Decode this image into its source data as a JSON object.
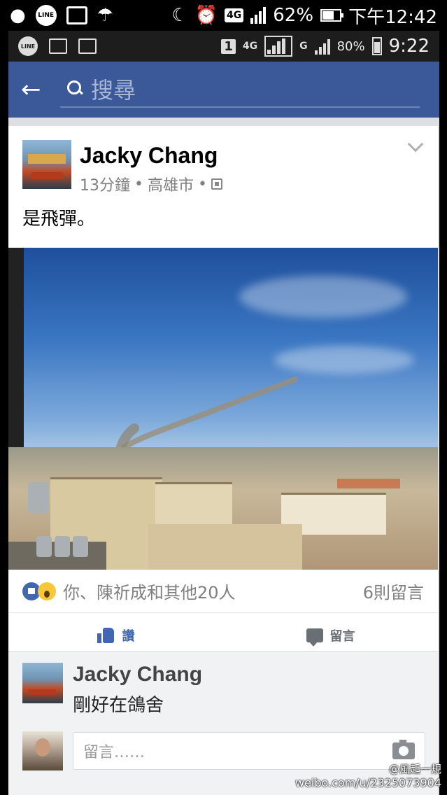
{
  "outer_status": {
    "line_label": "LINE",
    "battery_pct": "62%",
    "time": "下午12:42",
    "net": "4G"
  },
  "inner_status": {
    "line_label": "LINE",
    "sim": "1",
    "net1": "4G",
    "net2": "G",
    "battery_pct": "80%",
    "time": "9:22"
  },
  "header": {
    "search_placeholder": "搜尋"
  },
  "post": {
    "author": "Jacky Chang",
    "time": "13分鐘",
    "location": "高雄市",
    "text": "是飛彈。",
    "reactions_text": "你、陳祈成和其他20人",
    "comment_count": "6則留言",
    "like_label": "讚",
    "comment_label": "留言"
  },
  "comments": [
    {
      "author": "Jacky Chang",
      "text": "剛好在鴿舍"
    }
  ],
  "composer": {
    "placeholder": "留言……"
  },
  "watermark": {
    "line1": "@風起一規",
    "line2": "weibo.com/u/2325073904"
  },
  "colors": {
    "fb_blue": "#3b5998",
    "like_blue": "#4267b2"
  }
}
